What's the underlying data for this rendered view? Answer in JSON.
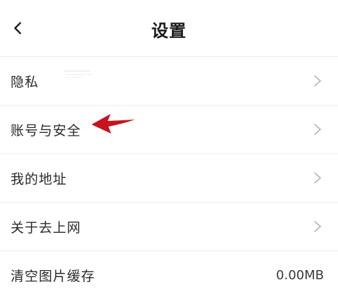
{
  "header": {
    "title": "设置",
    "back_icon": "chevron-left-icon"
  },
  "settings": {
    "items": [
      {
        "label": "隐私",
        "icon": "chevron-right-icon"
      },
      {
        "label": "账号与安全",
        "icon": "chevron-right-icon"
      },
      {
        "label": "我的地址",
        "icon": "chevron-right-icon"
      },
      {
        "label": "关于去上网",
        "icon": "chevron-right-icon"
      },
      {
        "label": "清空图片缓存",
        "value": "0.00MB"
      }
    ]
  },
  "colors": {
    "background": "#ffffff",
    "divider": "#ededed",
    "chevron": "#b3b3b3",
    "annotation_arrow": "#c8141c"
  }
}
